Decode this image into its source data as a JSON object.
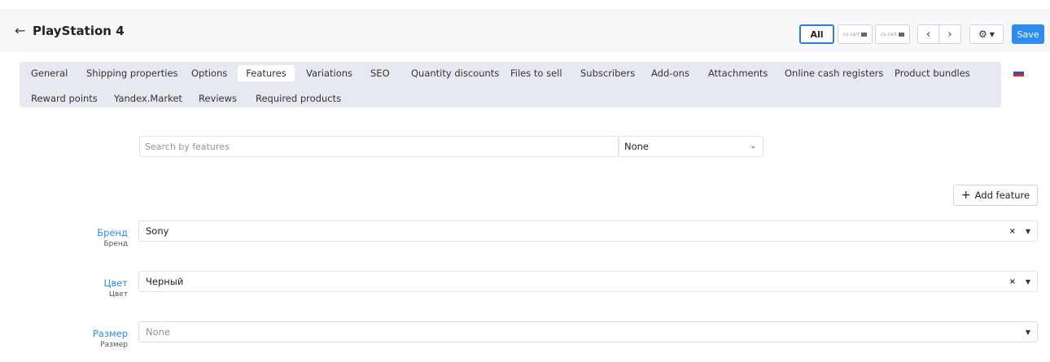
{
  "header": {
    "title": "PlayStation 4",
    "all_label": "All",
    "cs_cart_label": "cs cart",
    "save_label": "Save"
  },
  "tabs": [
    {
      "label": "General"
    },
    {
      "label": "Shipping properties"
    },
    {
      "label": "Options"
    },
    {
      "label": "Features",
      "active": true
    },
    {
      "label": "Variations"
    },
    {
      "label": "SEO"
    },
    {
      "label": "Quantity discounts"
    },
    {
      "label": "Files to sell"
    },
    {
      "label": "Subscribers"
    },
    {
      "label": "Add-ons"
    },
    {
      "label": "Attachments"
    },
    {
      "label": "Online cash registers"
    },
    {
      "label": "Product bundles"
    },
    {
      "label": "Reward points"
    },
    {
      "label": "Yandex.Market"
    },
    {
      "label": "Reviews"
    },
    {
      "label": "Required products"
    }
  ],
  "search": {
    "placeholder": "Search by features",
    "filter_value": "None"
  },
  "add_feature_label": "Add feature",
  "features": [
    {
      "label": "Бренд",
      "sublabel": "Бренд",
      "value": "Sony",
      "clearable": true
    },
    {
      "label": "Цвет",
      "sublabel": "Цвет",
      "value": "Черный",
      "clearable": true
    },
    {
      "label": "Размер",
      "sublabel": "Размер",
      "value": "None",
      "clearable": false
    }
  ],
  "colors": {
    "accent": "#2d8cf0",
    "tab_panel_bg": "#e6eaf0"
  },
  "icons": {
    "back": "arrow-left-icon",
    "prev": "chevron-left-icon",
    "next": "chevron-right-icon",
    "settings": "gear-icon",
    "add": "plus-icon",
    "flag": "russian-flag-icon"
  }
}
